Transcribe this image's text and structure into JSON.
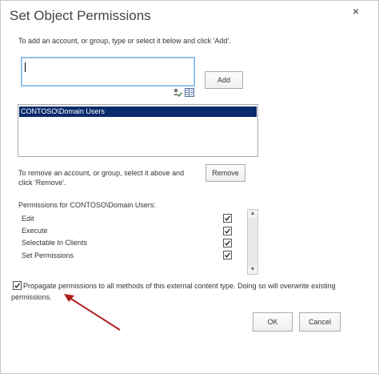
{
  "dialog": {
    "title": "Set Object Permissions",
    "close_glyph": "×"
  },
  "add_section": {
    "instruction": "To add an account, or group, type or select it below and click 'Add'.",
    "input_value": "",
    "add_button": "Add"
  },
  "accounts": {
    "items": [
      "CONTOSO\\Domain Users"
    ]
  },
  "remove_section": {
    "instruction": "To remove an account, or group, select it above and click 'Remove'.",
    "remove_button": "Remove"
  },
  "permissions": {
    "heading": "Permissions for CONTOSO\\Domain Users:",
    "items": [
      {
        "label": "Edit",
        "checked": true
      },
      {
        "label": "Execute",
        "checked": true
      },
      {
        "label": "Selectable In Clients",
        "checked": true
      },
      {
        "label": "Set Permissions",
        "checked": true
      }
    ]
  },
  "propagate": {
    "label": "Propagate permissions to all methods of this external content type. Doing so will overwrite existing permissions.",
    "checked": true
  },
  "footer": {
    "ok_button": "OK",
    "cancel_button": "Cancel"
  },
  "colors": {
    "selection": "#0a2a6b",
    "arrow": "#b01e1e",
    "input_border": "#7eb4ea"
  }
}
